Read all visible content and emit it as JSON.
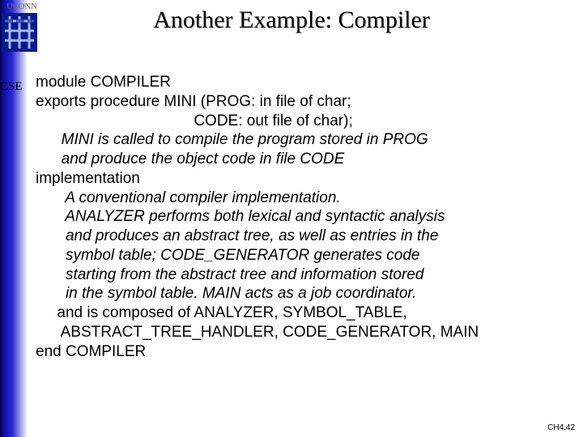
{
  "header": {
    "uconn": "UCONN",
    "cse": "CSE"
  },
  "title": "Another Example: Compiler",
  "body": {
    "l1": "module COMPILER",
    "l2": "exports procedure MINI (PROG: in file of char;",
    "l3": "                                     CODE: out file of char);",
    "c1": "      MINI is called to compile the program stored in PROG",
    "c2": "      and produce the object code in file CODE",
    "l4": "implementation",
    "c3": "       A conventional compiler implementation.",
    "c4": "       ANALYZER performs both lexical and syntactic analysis",
    "c5": "       and produces an abstract tree, as well as entries in the",
    "c6": "       symbol table; CODE_GENERATOR generates code",
    "c7": "       starting from the abstract tree and information stored",
    "c8": "       in the symbol table. MAIN acts as a job coordinator.",
    "l5": "     and is composed of ANALYZER, SYMBOL_TABLE,",
    "l6": "      ABSTRACT_TREE_HANDLER, CODE_GENERATOR, MAIN",
    "l7": "end COMPILER"
  },
  "footer": "CH4.42"
}
